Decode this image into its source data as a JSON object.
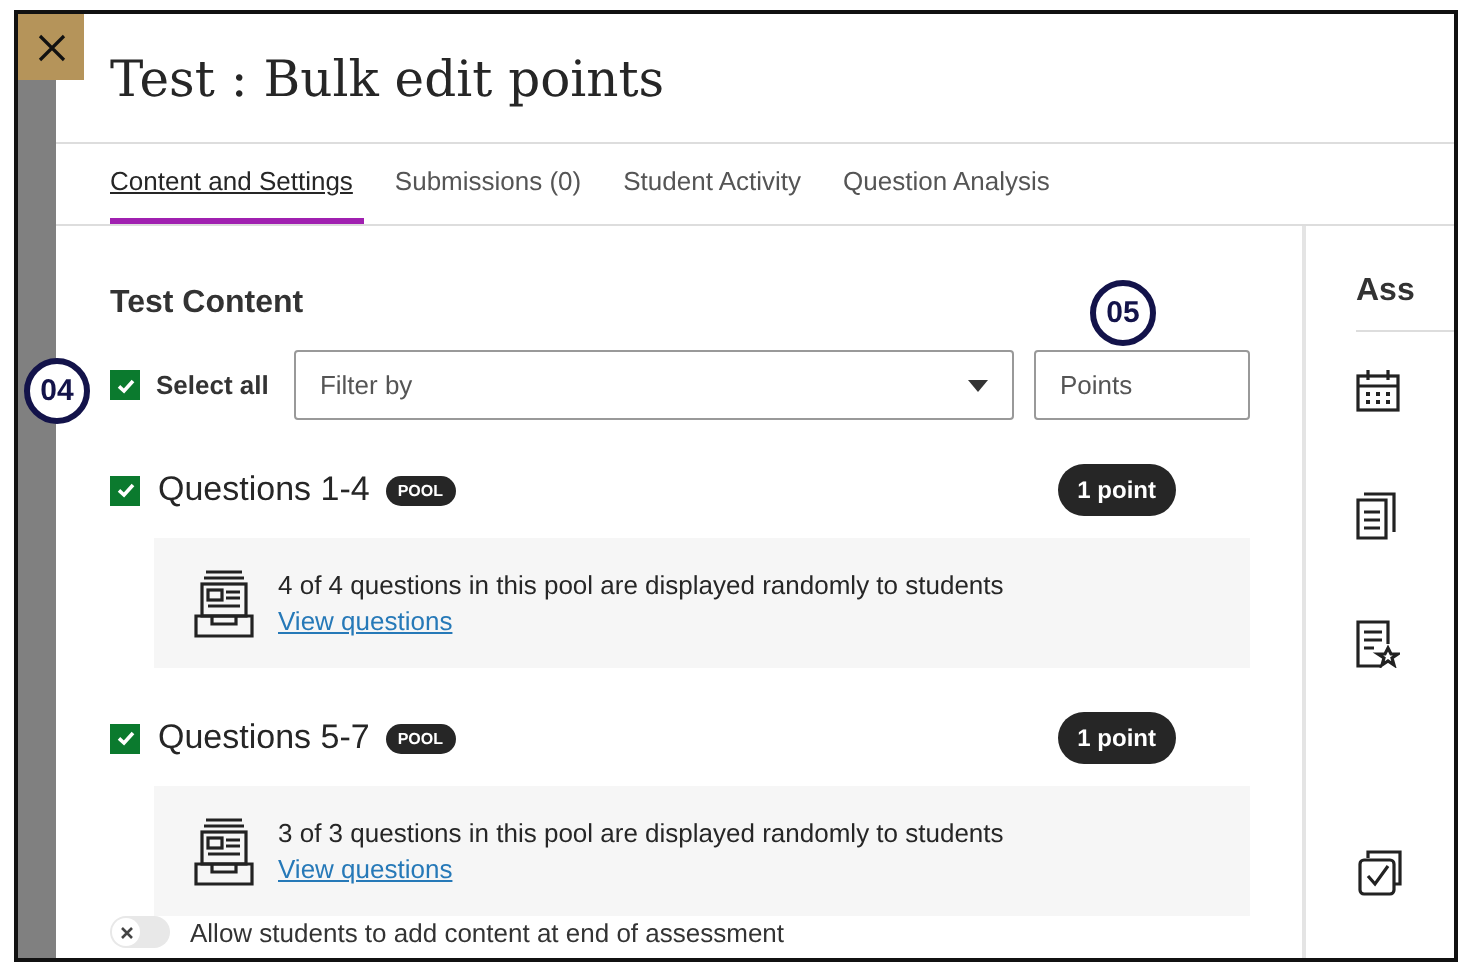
{
  "window": {
    "title": "Test : Bulk edit points"
  },
  "tabs": [
    {
      "label": "Content and Settings",
      "selected": true
    },
    {
      "label": "Submissions (0)",
      "selected": false
    },
    {
      "label": "Student Activity",
      "selected": false
    },
    {
      "label": "Question Analysis",
      "selected": false
    }
  ],
  "content": {
    "heading": "Test Content",
    "select_all": {
      "label": "Select all",
      "checked": true
    },
    "filter": {
      "placeholder": "Filter by"
    },
    "points": {
      "placeholder": "Points"
    },
    "pools": [
      {
        "title": "Questions 1-4",
        "badge": "POOL",
        "points": "1 point",
        "checked": true,
        "description": "4 of 4 questions in this pool are displayed randomly to students",
        "link": "View questions"
      },
      {
        "title": "Questions 5-7",
        "badge": "POOL",
        "points": "1 point",
        "checked": true,
        "description": "3 of 3 questions in this pool are displayed randomly to students",
        "link": "View questions"
      }
    ],
    "toggle": {
      "label": "Allow students to add content at end of assessment",
      "on": false
    }
  },
  "side_panel": {
    "title": "Ass"
  },
  "callouts": [
    {
      "label": "04"
    },
    {
      "label": "05"
    }
  ]
}
